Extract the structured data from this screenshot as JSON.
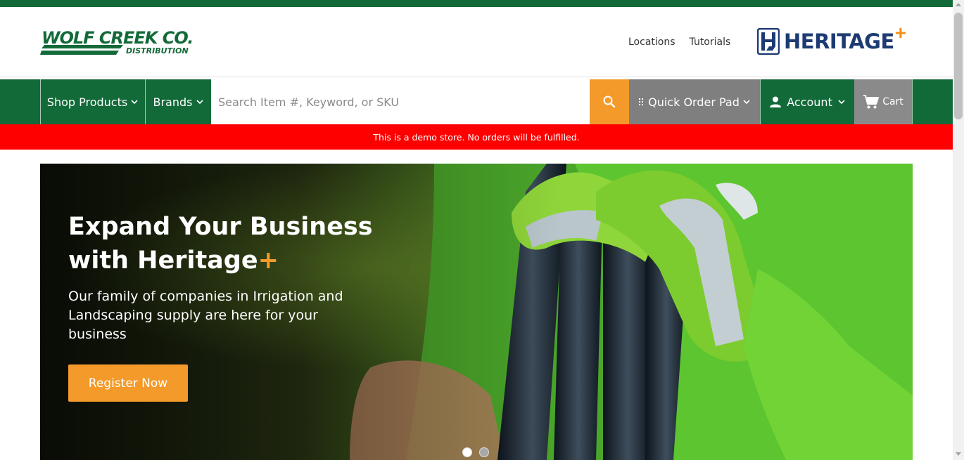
{
  "brand": {
    "name": "WOLF CREEK CO.",
    "sub": "DISTRIBUTION",
    "color": "#136a39"
  },
  "utility_links": {
    "locations": "Locations",
    "tutorials": "Tutorials"
  },
  "partner_logo": {
    "word": "HERITAGE",
    "plus": "+",
    "color": "#1d3b72",
    "accent": "#f4901f"
  },
  "nav": {
    "shop_products": "Shop Products",
    "brands": "Brands",
    "search_placeholder": "Search Item #, Keyword, or SKU",
    "quick_order_pad": "Quick Order Pad",
    "account": "Account",
    "cart": "Cart",
    "icons": [
      "chevron-down-icon",
      "search-icon",
      "grid-dots-icon",
      "user-icon",
      "cart-icon"
    ]
  },
  "banner": {
    "text": "This is a demo store. No orders will be fulfilled.",
    "color": "#ff0000"
  },
  "hero": {
    "title_line1": "Expand Your Business",
    "title_line2": "with Heritage",
    "title_plus": "+",
    "subtitle": "Our family of companies in Irrigation and Landscaping supply are here for your business",
    "cta": "Register Now",
    "slides_total": 2,
    "active_slide": 1,
    "accent": "#f39a2b"
  }
}
